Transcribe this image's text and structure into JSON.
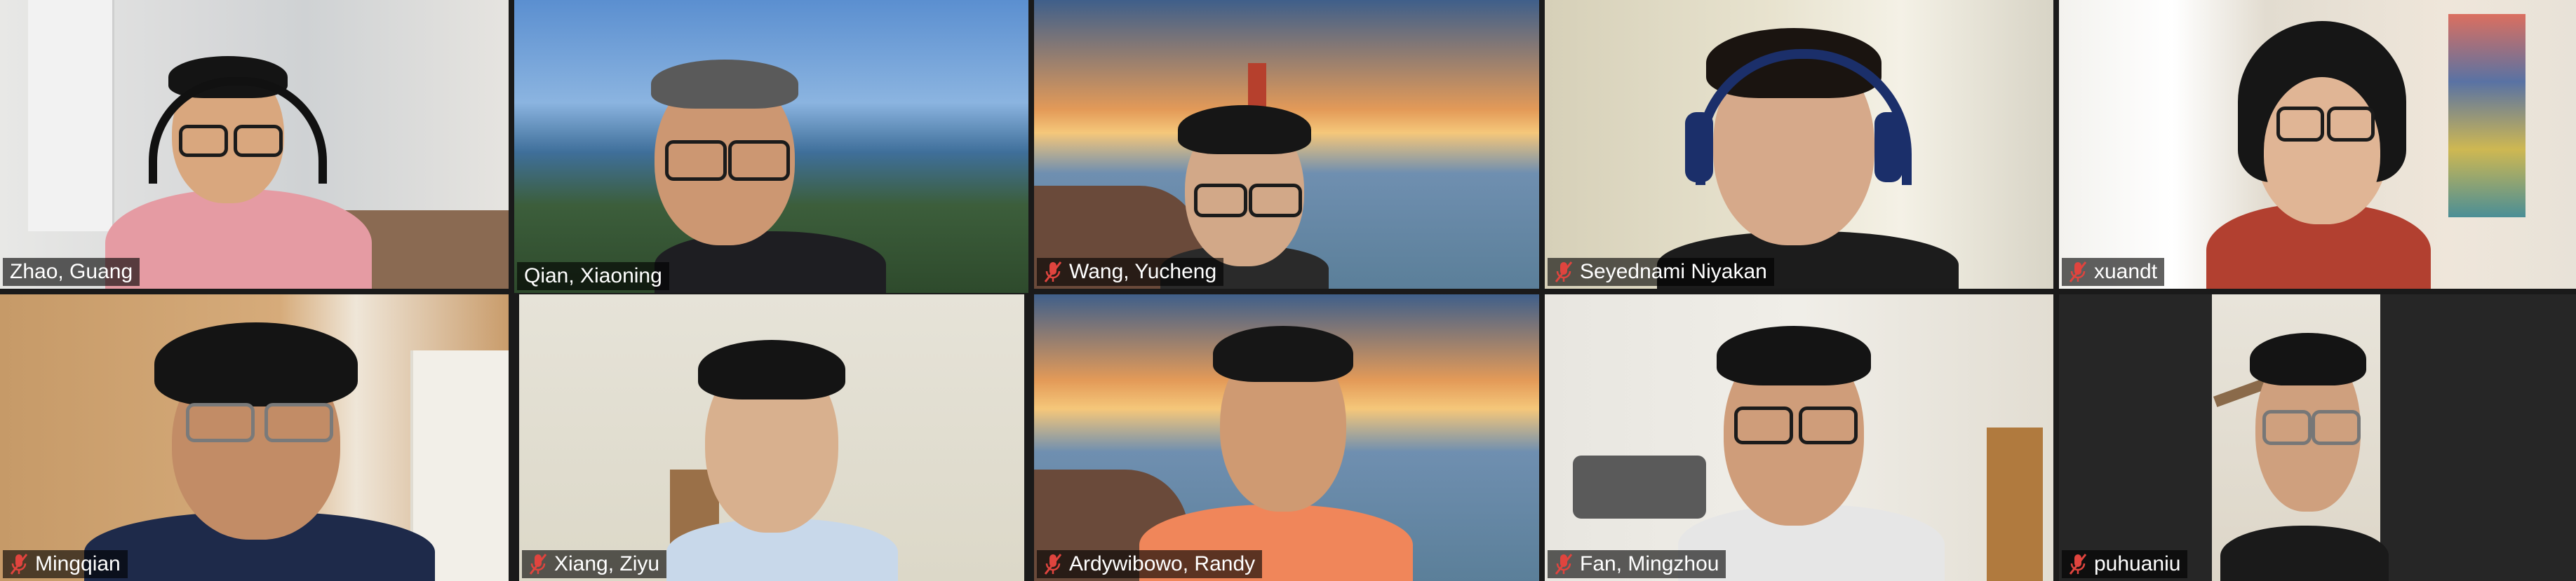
{
  "participants": [
    {
      "name": "Zhao, Guang",
      "muted": false,
      "active": false,
      "bg": "office-room"
    },
    {
      "name": "Qian, Xiaoning",
      "muted": false,
      "active": true,
      "bg": "coast-view"
    },
    {
      "name": "Wang, Yucheng",
      "muted": true,
      "active": false,
      "bg": "golden-gate-bridge"
    },
    {
      "name": "Seyednami Niyakan",
      "muted": true,
      "active": false,
      "bg": "room-corner"
    },
    {
      "name": "xuandt",
      "muted": true,
      "active": false,
      "bg": "bedroom-window"
    },
    {
      "name": "Mingqian",
      "muted": true,
      "active": false,
      "bg": "office-window"
    },
    {
      "name": "Xiang, Ziyu",
      "muted": true,
      "active": false,
      "bg": "office-door"
    },
    {
      "name": "Ardywibowo, Randy",
      "muted": true,
      "active": false,
      "bg": "golden-gate-bridge"
    },
    {
      "name": "Fan, Mingzhou",
      "muted": true,
      "active": false,
      "bg": "lab-room"
    },
    {
      "name": "puhuaniu",
      "muted": true,
      "active": false,
      "bg": "room-ceiling-fan"
    }
  ],
  "colors": {
    "active_border": "#d9ef6a",
    "mute_icon": "#e0443e",
    "grid_background": "#1a1a1a"
  },
  "icons": {
    "muted": "microphone-muted-icon"
  }
}
